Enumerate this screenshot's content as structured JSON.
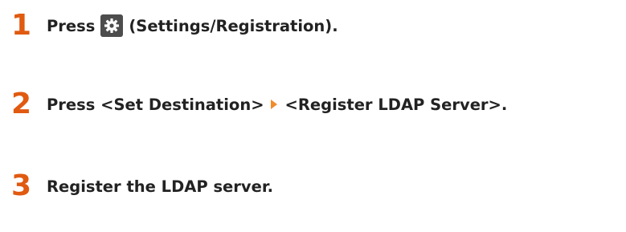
{
  "steps": [
    {
      "number": "1",
      "before_icon": "Press",
      "icon": "settings-gear-icon",
      "after_icon": "(Settings/Registration)."
    },
    {
      "number": "2",
      "before_arrow": "Press <Set Destination>",
      "arrow_icon": "orange-triangle-arrow-icon",
      "after_arrow": "<Register LDAP Server>."
    },
    {
      "number": "3",
      "text": "Register the LDAP server."
    }
  ],
  "colors": {
    "step_number": "#e05a10",
    "text": "#222222",
    "icon_bg": "#4d4d4d",
    "arrow": "#f08c2a"
  }
}
